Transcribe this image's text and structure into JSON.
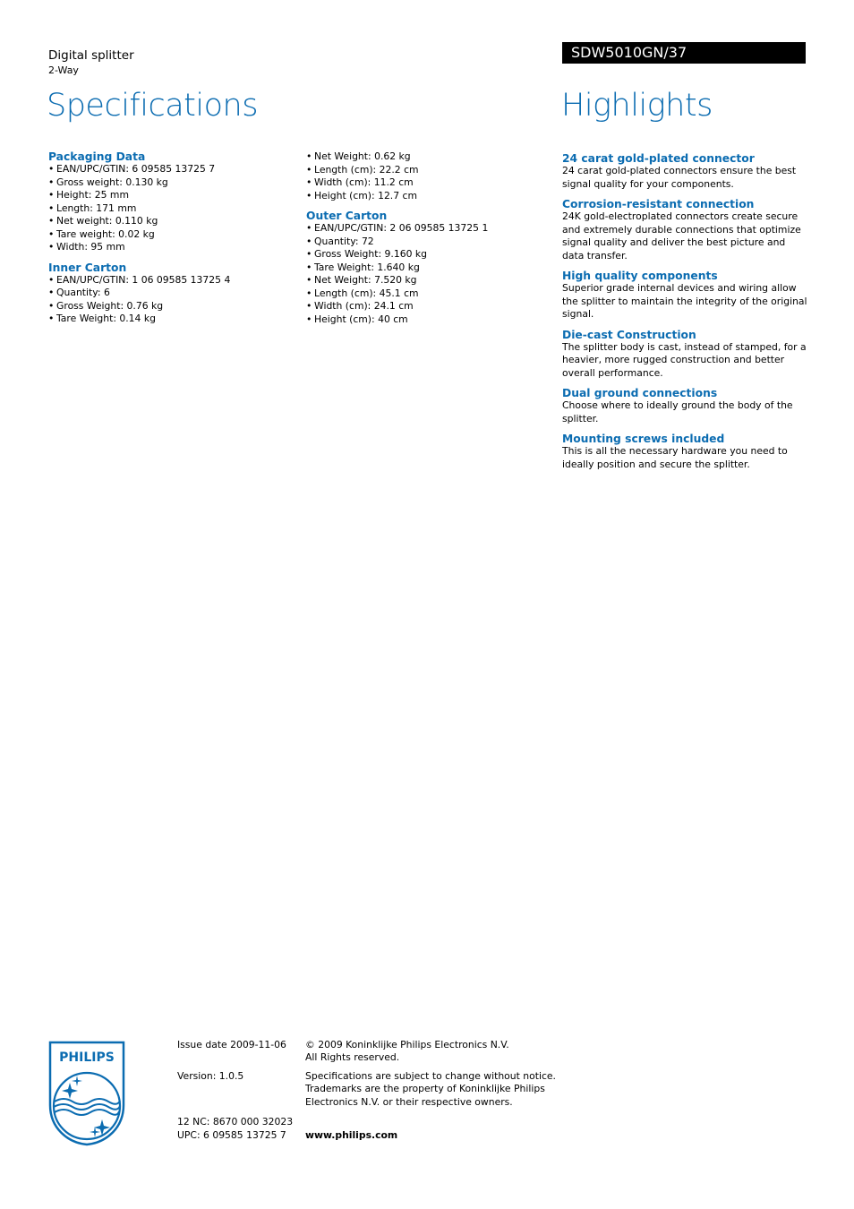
{
  "header": {
    "product_name": "Digital splitter",
    "product_sub": "2-Way",
    "model": "SDW5010GN/37",
    "specifications_title": "Specifications",
    "highlights_title": "Highlights"
  },
  "colors": {
    "accent": "#0b6cb1",
    "model_bar": "#000000"
  },
  "specifications": {
    "packaging_data": {
      "title": "Packaging Data",
      "items": [
        "EAN/UPC/GTIN: 6 09585 13725 7",
        "Gross weight: 0.130 kg",
        "Height: 25 mm",
        "Length: 171 mm",
        "Net weight: 0.110 kg",
        "Tare weight: 0.02 kg",
        "Width: 95 mm"
      ]
    },
    "inner_carton": {
      "title": "Inner Carton",
      "items": [
        "EAN/UPC/GTIN: 1 06 09585 13725 4",
        "Quantity: 6",
        "Gross Weight: 0.76 kg",
        "Tare Weight: 0.14 kg",
        "Net Weight: 0.62 kg",
        "Length (cm): 22.2 cm",
        "Width (cm): 11.2 cm",
        "Height (cm): 12.7 cm"
      ]
    },
    "outer_carton": {
      "title": "Outer Carton",
      "items": [
        "EAN/UPC/GTIN: 2 06 09585 13725 1",
        "Quantity: 72",
        "Gross Weight: 9.160 kg",
        "Tare Weight: 1.640 kg",
        "Net Weight: 7.520 kg",
        "Length (cm): 45.1 cm",
        "Width (cm): 24.1 cm",
        "Height (cm): 40 cm"
      ]
    }
  },
  "highlights": [
    {
      "title": "24 carat gold-plated connector",
      "body": "24 carat gold-plated connectors ensure the best signal quality for your components."
    },
    {
      "title": "Corrosion-resistant connection",
      "body": "24K gold-electroplated connectors create secure and extremely durable connections that optimize signal quality and deliver the best picture and data transfer."
    },
    {
      "title": "High quality components",
      "body": "Superior grade internal devices and wiring allow the splitter to maintain the integrity of the original signal."
    },
    {
      "title": "Die-cast Construction",
      "body": "The splitter body is cast, instead of stamped, for a heavier, more rugged construction and better overall performance."
    },
    {
      "title": "Dual ground connections",
      "body": "Choose where to ideally ground the body of the splitter."
    },
    {
      "title": "Mounting screws included",
      "body": "This is all the necessary hardware you need to ideally position and secure the splitter."
    }
  ],
  "footer": {
    "logo_text": "PHILIPS",
    "issue_date": "Issue date 2009-11-06",
    "version": "Version: 1.0.5",
    "nc": "12 NC: 8670 000 32023",
    "upc": "UPC: 6 09585 13725 7",
    "copyright_line1": "© 2009 Koninklijke Philips Electronics N.V.",
    "copyright_line2": "All Rights reserved.",
    "notice_line1": "Specifications are subject to change without notice.",
    "notice_line2": "Trademarks are the property of Koninklijke Philips",
    "notice_line3": "Electronics N.V. or their respective owners.",
    "website": "www.philips.com"
  }
}
